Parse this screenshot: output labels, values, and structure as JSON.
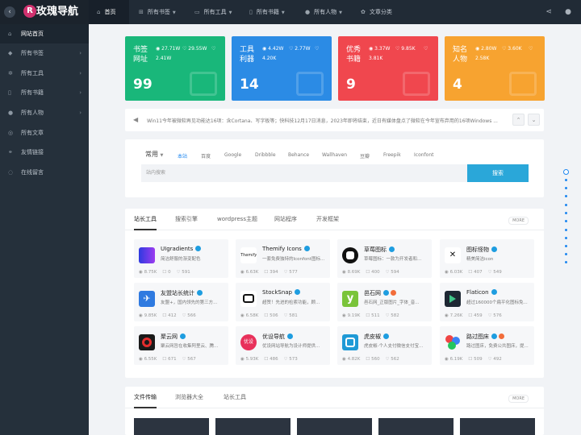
{
  "header": {
    "back_icon": "chevron-left-icon",
    "logo_char": "R",
    "logo_text": "玫瑰导航",
    "nav": [
      {
        "label": "首页",
        "icon": "home-icon",
        "active": true,
        "caret": false
      },
      {
        "label": "所有书签",
        "icon": "bookmark-icon",
        "active": false,
        "caret": true
      },
      {
        "label": "所有工具",
        "icon": "tools-icon",
        "active": false,
        "caret": true
      },
      {
        "label": "所有书籍",
        "icon": "book-icon",
        "active": false,
        "caret": true
      },
      {
        "label": "所有人物",
        "icon": "user-icon",
        "active": false,
        "caret": true
      },
      {
        "label": "文章分类",
        "icon": "gear-icon",
        "active": false,
        "caret": false
      }
    ]
  },
  "sidebar": {
    "items": [
      {
        "label": "网站首页",
        "icon": "home-icon",
        "active": true,
        "arrow": false
      },
      {
        "label": "所有书签",
        "icon": "tag-icon",
        "active": false,
        "arrow": true
      },
      {
        "label": "所有工具",
        "icon": "gear-icon",
        "active": false,
        "arrow": true
      },
      {
        "label": "所有书籍",
        "icon": "book-icon",
        "active": false,
        "arrow": true
      },
      {
        "label": "所有人物",
        "icon": "user-icon",
        "active": false,
        "arrow": true
      },
      {
        "label": "所有文章",
        "icon": "globe-icon",
        "active": false,
        "arrow": false
      },
      {
        "label": "友情链接",
        "icon": "link-icon",
        "active": false,
        "arrow": false
      },
      {
        "label": "在线留言",
        "icon": "chat-icon",
        "active": false,
        "arrow": false
      }
    ]
  },
  "stats": [
    {
      "title": "书签网址",
      "views": "27.71W",
      "likes": "29.55W",
      "extra": "2.41W",
      "count": "99",
      "color": "#19b77a"
    },
    {
      "title": "工具利器",
      "views": "4.42W",
      "likes": "2.77W",
      "extra": "4.20K",
      "count": "14",
      "color": "#2b8be5"
    },
    {
      "title": "优秀书籍",
      "views": "3.37W",
      "likes": "9.85K",
      "extra": "3.81K",
      "count": "9",
      "color": "#f0474e"
    },
    {
      "title": "知名人物",
      "views": "2.80W",
      "likes": "3.60K",
      "extra": "2.58K",
      "count": "4",
      "color": "#f7a330"
    }
  ],
  "ticker": {
    "icon": "megaphone-icon",
    "text": "Win11今年被微软再见功能达16项：含Cortana、写字板等；快科技12月17日消息，2023年即将结束，近日有媒体盘点了微软在今年宣布弃用的16项Windows ...",
    "up_icon": "chevron-up-icon",
    "down_icon": "chevron-down-icon"
  },
  "search": {
    "category": "常用",
    "tabs": [
      "本站",
      "百度",
      "Google",
      "Dribbble",
      "Behance",
      "Wallhaven",
      "豆瓣",
      "Freepik",
      "Iconfont"
    ],
    "placeholder": "站内搜索",
    "button": "搜索"
  },
  "panel1": {
    "tabs": [
      "站长工具",
      "搜索引擎",
      "wordpress主题",
      "网站程序",
      "开发框架"
    ],
    "more": "MORE",
    "tiles": [
      {
        "name": "UIgradients",
        "desc": "简洁舒服的渐变配色",
        "views": "8.75K",
        "comments": "0",
        "likes": "591",
        "icon": "uigradients-logo-icon",
        "hot": false
      },
      {
        "name": "Themify Icons",
        "desc": "一套免费独特的Iconfont图标...",
        "views": "6.63K",
        "comments": "394",
        "likes": "577",
        "icon": "themify-logo-icon",
        "hot": false
      },
      {
        "name": "草莓图标",
        "desc": "草莓图标：一款为开发者和...",
        "views": "8.69K",
        "comments": "400",
        "likes": "594",
        "icon": "caomei-logo-icon",
        "hot": false
      },
      {
        "name": "图标怪物",
        "desc": "精美简洁icon",
        "views": "6.03K",
        "comments": "407",
        "likes": "549",
        "icon": "icon-monster-logo-icon",
        "hot": false
      },
      {
        "name": "友盟站长统计",
        "desc": "友盟+，国内领先的第三方...",
        "views": "9.85K",
        "comments": "412",
        "likes": "566",
        "icon": "umeng-logo-icon",
        "hot": false
      },
      {
        "name": "StockSnap",
        "desc": "超赞！先进的检索功能，顾...",
        "views": "6.58K",
        "comments": "506",
        "likes": "581",
        "icon": "camera-icon",
        "hot": false
      },
      {
        "name": "邑石网",
        "desc": "邑石网_正版图片_字体_音...",
        "views": "9.19K",
        "comments": "511",
        "likes": "582",
        "icon": "yishi-logo-icon",
        "hot": true
      },
      {
        "name": "Flaticon",
        "desc": "超过160000个扁平化图标免...",
        "views": "7.26K",
        "comments": "459",
        "likes": "576",
        "icon": "flaticon-logo-icon",
        "hot": false
      },
      {
        "name": "聚云网",
        "desc": "聚云网旨在收集阿里云、腾...",
        "views": "6.55K",
        "comments": "671",
        "likes": "567",
        "icon": "juyun-logo-icon",
        "hot": false
      },
      {
        "name": "优设导航",
        "desc": "优设网站导航为设计师提供...",
        "views": "5.93K",
        "comments": "486",
        "likes": "573",
        "icon": "youshe-logo-icon",
        "hot": false
      },
      {
        "name": "虎皮椒",
        "desc": "虎皮椒-个人支付微信支付宝...",
        "views": "4.82K",
        "comments": "560",
        "likes": "562",
        "icon": "hupijiao-logo-icon",
        "hot": false
      },
      {
        "name": "路过图床",
        "desc": "路过图床，免费公共图床，提...",
        "views": "6.19K",
        "comments": "509",
        "likes": "492",
        "icon": "luguo-logo-icon",
        "hot": true
      }
    ]
  },
  "panel2": {
    "tabs": [
      "文件传输",
      "浏览器大全",
      "站长工具"
    ],
    "more": "MORE"
  }
}
